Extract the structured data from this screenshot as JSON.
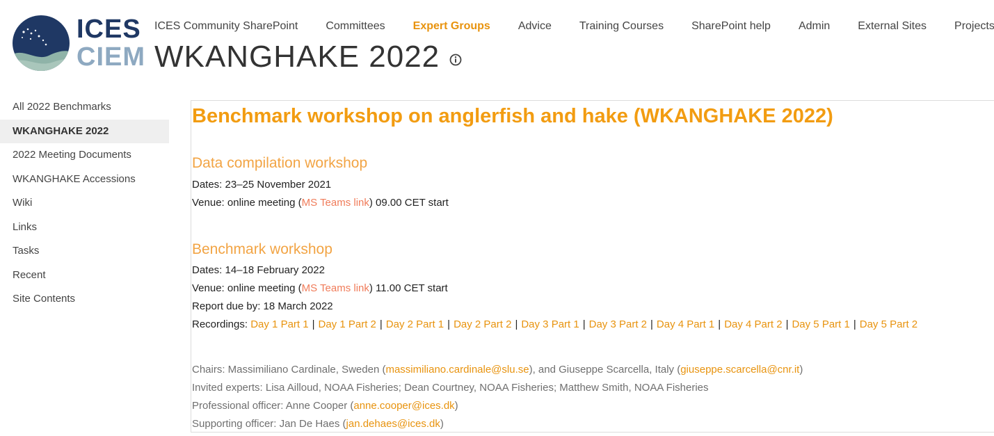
{
  "logo": {
    "top": "ICES",
    "bottom": "CIEM"
  },
  "colors": {
    "accent": "#e8930e",
    "heading": "#f29c11",
    "link_salmon": "#f07c5a",
    "logo_navy": "#1f3864"
  },
  "topnav": [
    {
      "label": "ICES Community SharePoint",
      "active": false
    },
    {
      "label": "Committees",
      "active": false
    },
    {
      "label": "Expert Groups",
      "active": true
    },
    {
      "label": "Advice",
      "active": false
    },
    {
      "label": "Training Courses",
      "active": false
    },
    {
      "label": "SharePoint help",
      "active": false
    },
    {
      "label": "Admin",
      "active": false
    },
    {
      "label": "External Sites",
      "active": false
    },
    {
      "label": "Projects",
      "active": false
    }
  ],
  "site_title": "WKANGHAKE 2022",
  "leftnav": [
    {
      "label": "All 2022 Benchmarks",
      "selected": false
    },
    {
      "label": "WKANGHAKE 2022",
      "selected": true
    },
    {
      "label": "2022 Meeting Documents",
      "selected": false
    },
    {
      "label": "WKANGHAKE Accessions",
      "selected": false
    },
    {
      "label": "Wiki",
      "selected": false
    },
    {
      "label": "Links",
      "selected": false
    },
    {
      "label": "Tasks",
      "selected": false
    },
    {
      "label": "Recent",
      "selected": false
    },
    {
      "label": "Site Contents",
      "selected": false
    }
  ],
  "content": {
    "heading": "Benchmark workshop on anglerfish and hake (WKANGHAKE 2022)",
    "data_compilation": {
      "title": "Data compilation workshop",
      "dates": "Dates: 23–25 November 2021",
      "venue_prefix": "Venue: online meeting (",
      "venue_link": "MS Teams link",
      "venue_suffix": ") 09.00 CET start"
    },
    "benchmark": {
      "title": "Benchmark workshop",
      "dates": "Dates: 14–18 February 2022",
      "venue_prefix": "Venue: online meeting (",
      "venue_link": "MS Teams link",
      "venue_suffix": ") 11.00 CET start",
      "report_due": "Report due by: 18 March 2022",
      "recordings_label": "Recordings: ",
      "recordings": [
        "Day 1 Part 1",
        "Day 1 Part 2",
        "Day 2 Part 1",
        "Day 2 Part 2",
        "Day 3 Part 1",
        "Day 3 Part 2",
        "Day 4 Part 1",
        "Day 4 Part 2",
        "Day 5 Part 1",
        "Day 5 Part 2"
      ],
      "separator": "|"
    },
    "people": {
      "chairs_prefix": "Chairs: Massimiliano Cardinale, Sweden (",
      "chair1_email": "massimiliano.cardinale@slu.se",
      "chairs_middle": "), and Giuseppe Scarcella, Italy (",
      "chair2_email": "giuseppe.scarcella@cnr.it",
      "chairs_suffix": ")",
      "invited": "Invited experts: Lisa Ailloud, NOAA Fisheries; Dean Courtney, NOAA Fisheries; Matthew Smith, NOAA Fisheries",
      "professional_prefix": "Professional officer: Anne Cooper (",
      "professional_email": "anne.cooper@ices.dk",
      "professional_suffix": ")",
      "supporting_prefix": "Supporting officer: Jan De Haes (",
      "supporting_email": "jan.dehaes@ices.dk",
      "supporting_suffix": ")"
    }
  }
}
